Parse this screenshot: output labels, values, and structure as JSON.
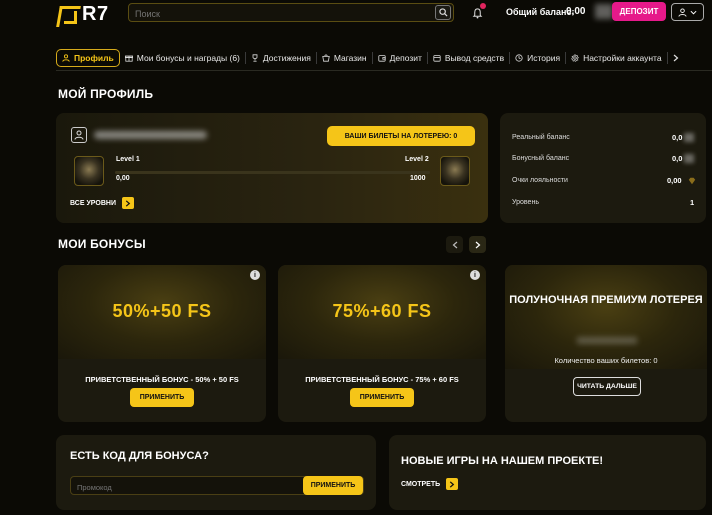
{
  "header": {
    "logo_text": "R7",
    "search_placeholder": "Поиск",
    "balance_label": "Общий баланс:",
    "balance_value": "0,00",
    "deposit_label": "ДЕПОЗИТ"
  },
  "nav": {
    "items": [
      {
        "label": "Профиль",
        "icon": "user-icon"
      },
      {
        "label": "Мои бонусы и награды (6)",
        "icon": "gift-icon"
      },
      {
        "label": "Достижения",
        "icon": "trophy-icon"
      },
      {
        "label": "Магазин",
        "icon": "shop-icon"
      },
      {
        "label": "Депозит",
        "icon": "wallet-icon"
      },
      {
        "label": "Вывод средств",
        "icon": "withdraw-icon"
      },
      {
        "label": "История",
        "icon": "history-icon"
      },
      {
        "label": "Настройки аккаунта",
        "icon": "settings-icon"
      }
    ]
  },
  "profile": {
    "title": "МОЙ ПРОФИЛЬ",
    "lottery_button": "ВАШИ БИЛЕТЫ НА ЛОТЕРЕЮ: 0",
    "level1_label": "Level 1",
    "level2_label": "Level 2",
    "progress_start": "0,00",
    "progress_end": "1000",
    "all_levels": "ВСЕ УРОВНИ"
  },
  "stats": {
    "real_balance_label": "Реальный баланс",
    "real_balance_value": "0,0",
    "bonus_balance_label": "Бонусный баланс",
    "bonus_balance_value": "0,0",
    "loyalty_label": "Очки лояльности",
    "loyalty_value": "0,00",
    "level_label": "Уровень",
    "level_value": "1"
  },
  "bonuses": {
    "title": "МОИ БОНУСЫ",
    "cards": [
      {
        "big": "50%+50 FS",
        "name": "ПРИВЕТСТВЕННЫЙ БОНУС - 50% + 50 FS",
        "button": "ПРИМЕНИТЬ"
      },
      {
        "big": "75%+60 FS",
        "name": "ПРИВЕТСТВЕННЫЙ БОНУС - 75% + 60 FS",
        "button": "ПРИМЕНИТЬ"
      }
    ],
    "lottery": {
      "title": "ПОЛУНОЧНАЯ ПРЕМИУМ ЛОТЕРЕЯ",
      "count": "Количество ваших билетов: 0",
      "button": "ЧИТАТЬ ДАЛЬШЕ"
    }
  },
  "promo": {
    "title": "ЕСТЬ КОД ДЛЯ БОНУСА?",
    "placeholder": "Промокод",
    "button": "ПРИМЕНИТЬ"
  },
  "games": {
    "title": "НОВЫЕ ИГРЫ НА НАШЕМ ПРОЕКТЕ!",
    "link": "СМОТРЕТЬ"
  },
  "colors": {
    "accent": "#f5c518",
    "deposit": "#e6198a",
    "background": "#0b0a05"
  }
}
